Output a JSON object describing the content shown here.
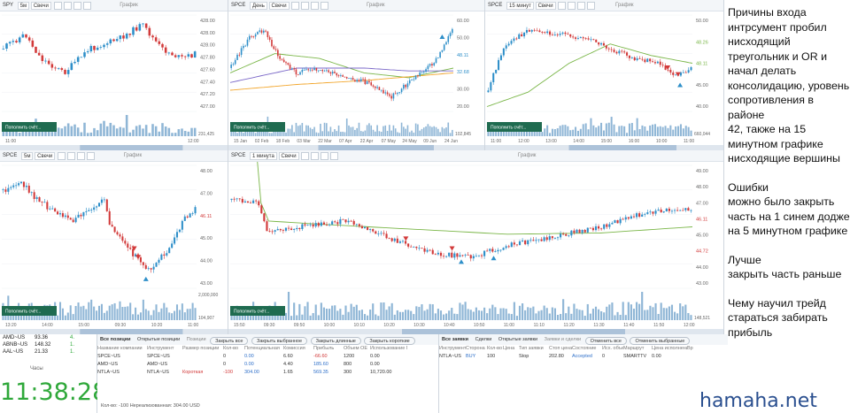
{
  "charts": [
    {
      "symbol": "SPY",
      "tf": "5м",
      "type": "Свечи",
      "title": "График",
      "ticks": [
        "428.00",
        "428.00",
        "428.00",
        "427.80",
        "427.60",
        "427.40",
        "427.20",
        "427.00"
      ],
      "times": [
        "11:00",
        "12:00"
      ],
      "vol": "231,425",
      "fill": "Пополнить счёт..."
    },
    {
      "symbol": "SPCE",
      "tf": "День",
      "type": "Свечи",
      "title": "График",
      "ticks": [
        "60.00",
        "50.00",
        "48.11",
        "32.68",
        "30.00",
        "20.00"
      ],
      "times": [
        "15 Jan",
        "02 Feb",
        "18 Feb",
        "03 Mar",
        "22 Mar",
        "07 Apr",
        "22 Apr",
        "07 May",
        "24 May",
        "09 Jun",
        "24 Jun"
      ],
      "vol": "102,845",
      "fill": "Пополнить счёт..."
    },
    {
      "symbol": "SPCE",
      "tf": "15 минут",
      "type": "Свечи",
      "title": "График",
      "ticks": [
        "50.00",
        "48.26",
        "48.11",
        "45.00",
        "40.00"
      ],
      "times": [
        "11:00",
        "12:00",
        "13:00",
        "14:00",
        "15:00",
        "16:00",
        "10:00",
        "11:00"
      ],
      "vol": "660,044",
      "fill": "Пополнить счёт..."
    },
    {
      "symbol": "SPCE",
      "tf": "5м",
      "type": "Свечи",
      "title": "График",
      "ticks": [
        "48.00",
        "47.00",
        "46.11",
        "45.00",
        "44.00",
        "43.00"
      ],
      "times": [
        "13:20",
        "14:00",
        "15:00",
        "09:30",
        "10:20",
        "11:00"
      ],
      "vol": "104,907",
      "volTop": "2,000,000",
      "fill": "Пополнить счёт..."
    },
    {
      "symbol": "SPCE",
      "tf": "1 минута",
      "type": "Свечи",
      "title": "График",
      "ticks": [
        "49.00",
        "48.00",
        "47.00",
        "46.11",
        "45.00",
        "44.72",
        "44.00",
        "43.00"
      ],
      "times": [
        "15:50",
        "09:30",
        "09:50",
        "10:00",
        "10:10",
        "10:20",
        "10:30",
        "10:40",
        "10:50",
        "11:00",
        "11:10",
        "11:20",
        "11:30",
        "11:40",
        "11:50",
        "12:00"
      ],
      "vol": "148,521",
      "fill": "Пополнить счёт..."
    }
  ],
  "watchlist": {
    "rows": [
      [
        "AMD~US",
        "93.36",
        "4."
      ],
      [
        "ABNB~US",
        "148.32",
        "1."
      ],
      [
        "AAL~US",
        "21.33",
        "1."
      ]
    ],
    "clock_label": "Часы",
    "clock": "11:38:28"
  },
  "positions": {
    "tabs": [
      "Все позиции",
      "Открытые позиции"
    ],
    "header_title": "Позиции",
    "buttons": [
      "Закрыть все",
      "Закрыть выбранное",
      "Закрыть длинные",
      "Закрыть короткие"
    ],
    "cols": [
      "Название компании",
      "Инструмент",
      "Размер позиции",
      "Кол-во",
      "Потенциальная",
      "Комиссия",
      "Прибыль",
      "Объем ОЕ",
      "Использование ГК"
    ],
    "rows": [
      [
        "SPCE~US",
        "SPCE~US",
        "",
        "0",
        "0.00",
        "6.60",
        "-66.60",
        "1200",
        "0.00"
      ],
      [
        "AMD~US",
        "AMD~US",
        "",
        "0",
        "0.00",
        "4.40",
        "185.60",
        "800",
        "0.00"
      ],
      [
        "NTLA~US",
        "NTLA~US",
        "Короткая",
        "-100",
        "304.00",
        "1.65",
        "569.35",
        "300",
        "10,720.00"
      ]
    ],
    "footer": "Кол-во: -100  Нереализованная: 304.00 USD"
  },
  "orders": {
    "tabs": [
      "Все заявки",
      "Сделки",
      "Открытые заявки"
    ],
    "header_title": "Заявки и сделки",
    "buttons": [
      "Отменить все",
      "Отменить выбранные"
    ],
    "cols": [
      "Инструмент",
      "Сторона",
      "Кол-во",
      "Цена",
      "Тип заявки",
      "Стоп цена",
      "Состояние",
      "Исх. объем",
      "Маршрут",
      "Цена исполнения",
      "Вр"
    ],
    "rows": [
      [
        "NTLA~US",
        "BUY",
        "100",
        "",
        "Stop",
        "202.80",
        "Accepted",
        "0",
        "SMARTTV",
        "0.00",
        ""
      ]
    ]
  },
  "notes": {
    "para1": "Причины входа интрсумент пробил нисходящий треугольник и OR и начал делать консолидацию, уровень сопротивления в районе\n42, также на 15 минутном графике нисходящие вершины",
    "para2": "Ошибки\n можно было закрыть часть на 1 синем додже на 5 минутном графике",
    "para3": "Лучше\nзакрыть часть раньше",
    "para4": "Чему научил трейд стараться забирать прибыль"
  },
  "watermark": "hamaha.net",
  "colors": {
    "up": "#2e8fc9",
    "down": "#d23a3a",
    "volume": "#8fb6d6",
    "accent_green": "#1f6b50",
    "sma_green": "#7ab648",
    "sma_purple": "#7b68c8",
    "sma_orange": "#f2a52a",
    "clock": "#2fa83a"
  }
}
